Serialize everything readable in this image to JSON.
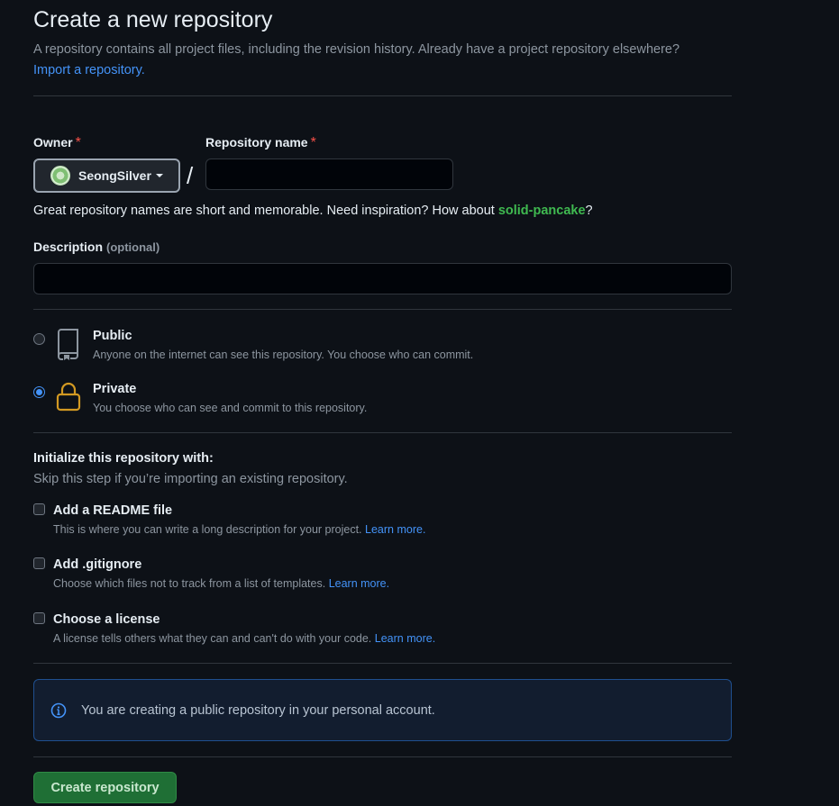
{
  "header": {
    "title": "Create a new repository",
    "subtitle": "A repository contains all project files, including the revision history. Already have a project repository elsewhere?",
    "import_link": "Import a repository."
  },
  "owner": {
    "label": "Owner",
    "required_mark": "*",
    "selected": "SeongSilver"
  },
  "repo_name": {
    "label": "Repository name",
    "required_mark": "*",
    "separator": "/",
    "value": ""
  },
  "hint": {
    "text": "Great repository names are short and memorable. Need inspiration? How about ",
    "suggestion": "solid-pancake",
    "end": "?"
  },
  "description": {
    "label": "Description",
    "optional": "(optional)",
    "value": ""
  },
  "visibility": {
    "selected": "private",
    "options": [
      {
        "id": "public",
        "title": "Public",
        "desc": "Anyone on the internet can see this repository. You choose who can commit."
      },
      {
        "id": "private",
        "title": "Private",
        "desc": "You choose who can see and commit to this repository."
      }
    ]
  },
  "initialize": {
    "title": "Initialize this repository with:",
    "subtitle": "Skip this step if you’re importing an existing repository.",
    "options": [
      {
        "title": "Add a README file",
        "desc": "This is where you can write a long description for your project.",
        "link": "Learn more."
      },
      {
        "title": "Add .gitignore",
        "desc": "Choose which files not to track from a list of templates.",
        "link": "Learn more."
      },
      {
        "title": "Choose a license",
        "desc": "A license tells others what they can and can't do with your code.",
        "link": "Learn more."
      }
    ]
  },
  "notice": {
    "text": "You are creating a public repository in your personal account."
  },
  "submit": {
    "label": "Create repository"
  },
  "colors": {
    "background": "#0d1117",
    "accent_link": "#4493f8",
    "success": "#3fb950",
    "danger": "#f85149",
    "lock": "#d29922",
    "button": "#1f6f35"
  },
  "icons": {
    "public": "repo-icon",
    "private": "lock-icon",
    "notice": "info-icon",
    "owner_caret": "triangle-down-icon"
  }
}
